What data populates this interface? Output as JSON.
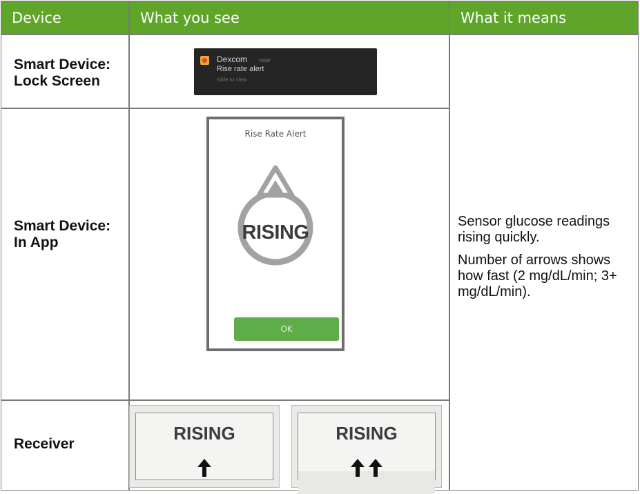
{
  "headers": [
    "Device",
    "What you see",
    "What it means"
  ],
  "rows": [
    {
      "device": "Smart Device:\nLock Screen"
    },
    {
      "device": "Smart Device:\nIn App"
    },
    {
      "device": "Receiver"
    }
  ],
  "lock_screen": {
    "app_name": "Dexcom",
    "time": "now",
    "message": "Rise rate alert",
    "subtext": "slide to view"
  },
  "in_app": {
    "title": "Rise Rate Alert",
    "status": "RISING",
    "button": "OK"
  },
  "receiver": {
    "screens": [
      {
        "status": "RISING",
        "arrows": 1
      },
      {
        "status": "RISING",
        "arrows": 2
      }
    ]
  },
  "meaning": {
    "line1": "Sensor glucose readings rising quickly.",
    "line2": "Number of arrows shows how fast (2 mg/dL/min; 3+ mg/dL/min)."
  },
  "colors": {
    "header_bg": "#5fa52a",
    "header_text": "#ffffff",
    "ok_button": "#5fad4a",
    "border": "#7a7a7a"
  }
}
